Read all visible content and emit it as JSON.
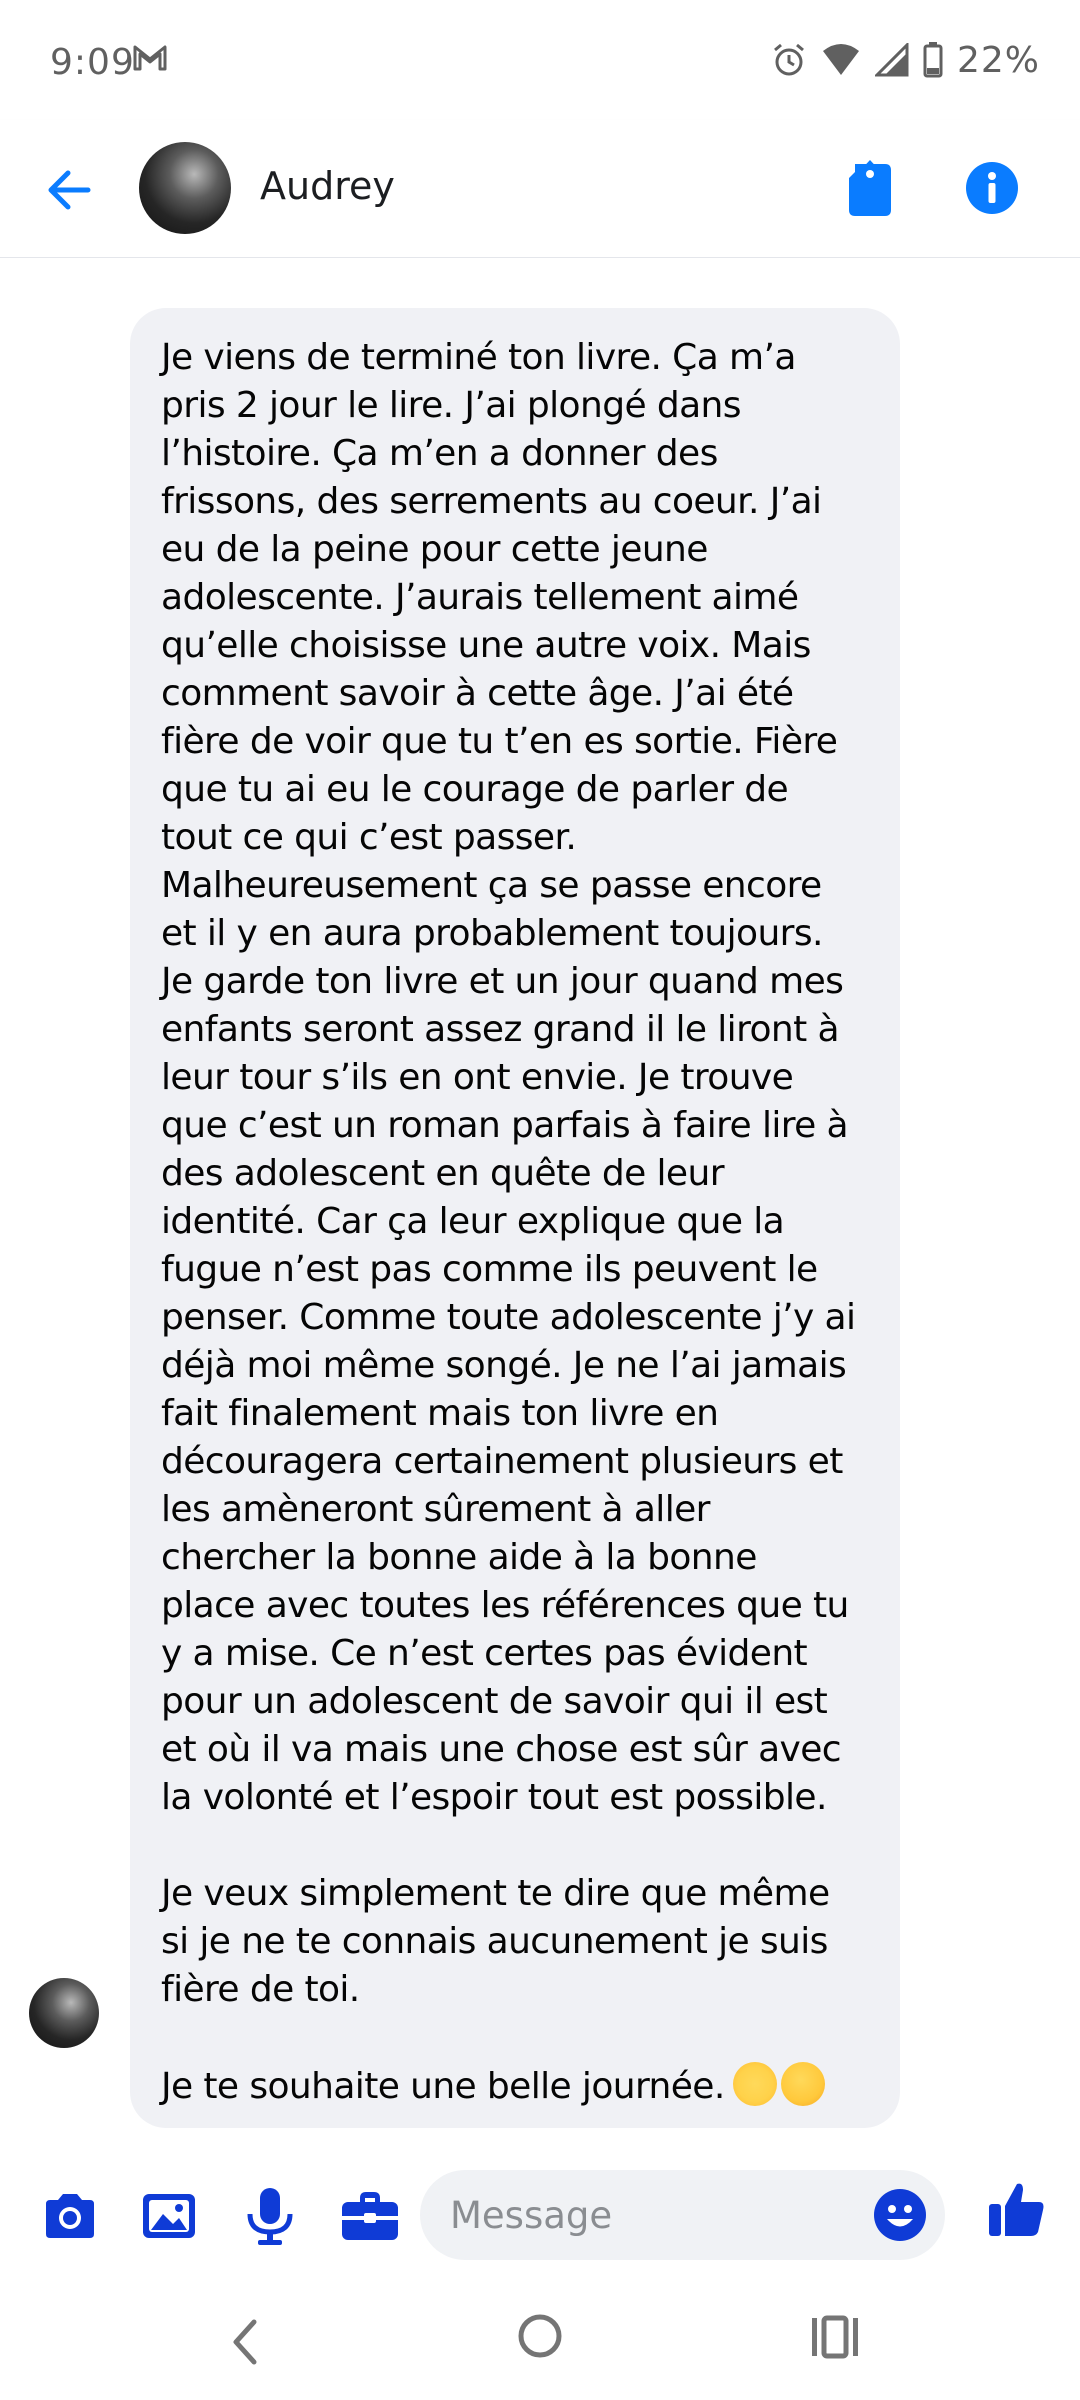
{
  "status_bar": {
    "time": "9:09",
    "battery": "22%",
    "icons": [
      "gmail-icon",
      "alarm-icon",
      "wifi-icon",
      "signal-icon",
      "battery-icon"
    ]
  },
  "header": {
    "contact_name": "Audrey",
    "icons": [
      "back-arrow-icon",
      "tag-icon",
      "info-icon"
    ]
  },
  "message": {
    "lines": [
      "Je viens de terminé ton livre. Ça m’a",
      "pris 2 jour le lire. J’ai plongé dans",
      "l’histoire. Ça m’en a donner des",
      "frissons, des serrements au coeur. J’ai",
      "eu de la peine pour cette jeune",
      "adolescente. J’aurais tellement aimé",
      "qu’elle choisisse une autre voix. Mais",
      "comment savoir à cette âge. J’ai été",
      "fière de voir que tu t’en es sortie. Fière",
      "que tu ai eu le courage de parler de",
      "tout ce qui c’est passer.",
      "Malheureusement ça se passe encore",
      "et il y en aura probablement toujours.",
      "Je garde ton livre et un jour quand mes",
      "enfants seront assez grand il le liront à",
      "leur tour s’ils en ont envie. Je trouve",
      "que c’est un roman parfais à faire lire à",
      "des adolescent en quête de leur",
      "identité. Car ça leur explique que la",
      "fugue n’est pas comme ils peuvent le",
      "penser. Comme toute adolescente j’y ai",
      "déjà moi même songé. Je ne l’ai jamais",
      "fait finalement mais ton livre en",
      "découragera certainement plusieurs et",
      "les amèneront sûrement à aller",
      "chercher la bonne aide à la bonne",
      "place avec toutes les références que tu",
      "y a mise. Ce n’est certes pas évident",
      "pour un adolescent de savoir qui il est",
      "et où il va mais une chose est sûr avec",
      "la volonté et l’espoir tout est possible.",
      "",
      "Je veux simplement te dire que même",
      "si je ne te connais aucunement je suis",
      "fière de toi.",
      "",
      "Je te souhaite une belle journée."
    ],
    "emojis": [
      "sun-with-face",
      "smiling-face"
    ]
  },
  "composer": {
    "placeholder": "Message",
    "tools": [
      "camera-icon",
      "gallery-icon",
      "microphone-icon",
      "briefcase-icon"
    ]
  },
  "colors": {
    "accent": "#0a7cff",
    "bubble": "#f0f1f5",
    "composer_tools": "#0f3bd6"
  }
}
